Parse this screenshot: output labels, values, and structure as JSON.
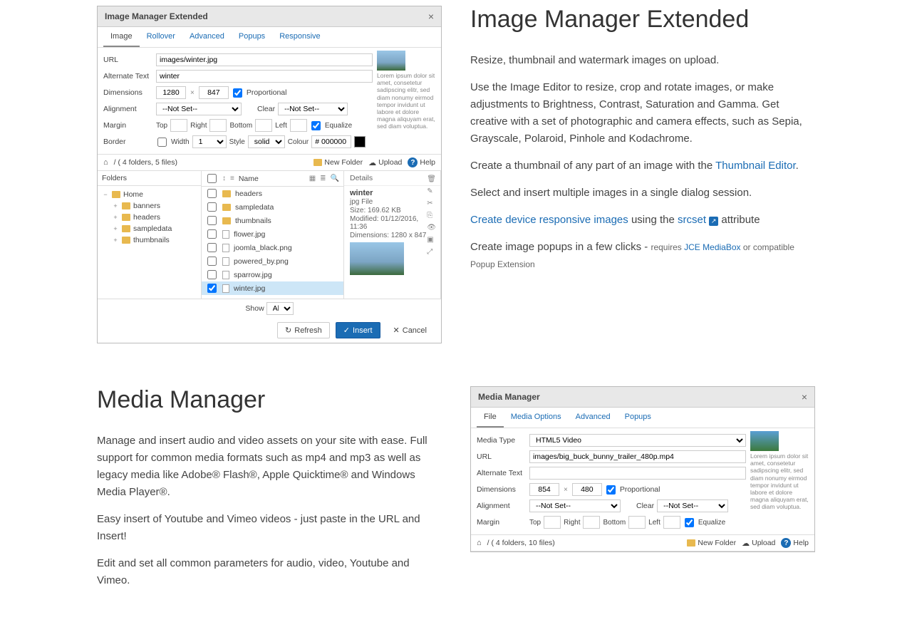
{
  "ime": {
    "title": "Image Manager Extended",
    "tabs": [
      "Image",
      "Rollover",
      "Advanced",
      "Popups",
      "Responsive"
    ],
    "fields": {
      "url_lbl": "URL",
      "url": "images/winter.jpg",
      "alt_lbl": "Alternate Text",
      "alt": "winter",
      "dim_lbl": "Dimensions",
      "dim_w": "1280",
      "dim_h": "847",
      "prop": "Proportional",
      "align_lbl": "Alignment",
      "align_val": "--Not Set--",
      "clear_lbl": "Clear",
      "clear_val": "--Not Set--",
      "margin_lbl": "Margin",
      "m_top": "Top",
      "m_right": "Right",
      "m_bottom": "Bottom",
      "m_left": "Left",
      "equalize": "Equalize",
      "border_lbl": "Border",
      "width_lbl": "Width",
      "width_val": "1",
      "style_lbl": "Style",
      "style_val": "solid",
      "colour_lbl": "Colour",
      "colour_val": "# 000000"
    },
    "lorem": "Lorem ipsum dolor sit amet, consetetur sadipscing elitr, sed diam nonumy eirmod tempor invidunt ut labore et dolore magna aliquyam erat, sed diam voluptua.",
    "crumb": "/ ( 4 folders, 5 files)",
    "new_folder": "New Folder",
    "upload": "Upload",
    "help": "Help",
    "folders_hdr": "Folders",
    "name_hdr": "Name",
    "details_hdr": "Details",
    "tree": [
      {
        "label": "Home",
        "toggle": "−",
        "indent": 0,
        "home": true
      },
      {
        "label": "banners",
        "toggle": "+",
        "indent": 1
      },
      {
        "label": "headers",
        "toggle": "+",
        "indent": 1
      },
      {
        "label": "sampledata",
        "toggle": "+",
        "indent": 1
      },
      {
        "label": "thumbnails",
        "toggle": "+",
        "indent": 1
      }
    ],
    "files": [
      {
        "name": "headers",
        "folder": true
      },
      {
        "name": "sampledata",
        "folder": true
      },
      {
        "name": "thumbnails",
        "folder": true
      },
      {
        "name": "flower.jpg"
      },
      {
        "name": "joomla_black.png"
      },
      {
        "name": "powered_by.png"
      },
      {
        "name": "sparrow.jpg"
      },
      {
        "name": "winter.jpg",
        "selected": true
      }
    ],
    "details": {
      "name": "winter",
      "type": "jpg File",
      "size": "Size: 169.62 KB",
      "mod": "Modified: 01/12/2016, 11:36",
      "dims": "Dimensions: 1280 x 847"
    },
    "show_lbl": "Show",
    "show_val": "All",
    "refresh": "Refresh",
    "insert": "Insert",
    "cancel": "Cancel",
    "desc": {
      "heading": "Image Manager Extended",
      "p1": "Resize, thumbnail and watermark images on upload.",
      "p2a": "Use the Image Editor to resize, crop and rotate images, or make adjustments to Brightness, Contrast, Saturation and Gamma. Get creative with a set of photographic and camera effects, such as Sepia, Grayscale, Polaroid, Pinhole and  Kodachrome.",
      "p3a": "Create a thumbnail of any part of an image with the ",
      "p3_link": "Thumbnail Editor",
      "p3b": ".",
      "p4": "Select and insert multiple images in a single dialog session.",
      "p5_link": "Create device responsive images",
      "p5b": " using the ",
      "p5_link2": "srcset",
      "p5c": " attribute",
      "p6a": "Create image popups in a few clicks - ",
      "p6_small": "requires ",
      "p6_link": "JCE MediaBox",
      "p6_end": " or compatible Popup Extension"
    }
  },
  "mm": {
    "heading": "Media Manager",
    "p1": "Manage and insert audio and video assets on your site with ease. Full support for  common media formats such as mp4 and mp3 as well as legacy media like Adobe® Flash®, Apple Quicktime® and Windows Media Player®.",
    "p2": "Easy insert of Youtube and Vimeo videos - just paste in the URL and Insert!",
    "p3": "Edit and set all common parameters for audio, video, Youtube and Vimeo.",
    "title": "Media Manager",
    "tabs": [
      "File",
      "Media Options",
      "Advanced",
      "Popups"
    ],
    "fields": {
      "type_lbl": "Media Type",
      "type_val": "HTML5 Video",
      "url_lbl": "URL",
      "url": "images/big_buck_bunny_trailer_480p.mp4",
      "alt_lbl": "Alternate Text",
      "dim_lbl": "Dimensions",
      "dim_w": "854",
      "dim_h": "480",
      "prop": "Proportional",
      "align_lbl": "Alignment",
      "align_val": "--Not Set--",
      "clear_lbl": "Clear",
      "clear_val": "--Not Set--",
      "margin_lbl": "Margin",
      "m_top": "Top",
      "m_right": "Right",
      "m_bottom": "Bottom",
      "m_left": "Left",
      "equalize": "Equalize"
    },
    "lorem": "Lorem ipsum dolor sit amet, consetetur sadipscing elitr, sed diam nonumy eirmod tempor invidunt ut labore et dolore magna aliquyam erat, sed diam voluptua.",
    "crumb": "/ ( 4 folders, 10 files)",
    "new_folder": "New Folder",
    "upload": "Upload",
    "help": "Help"
  }
}
